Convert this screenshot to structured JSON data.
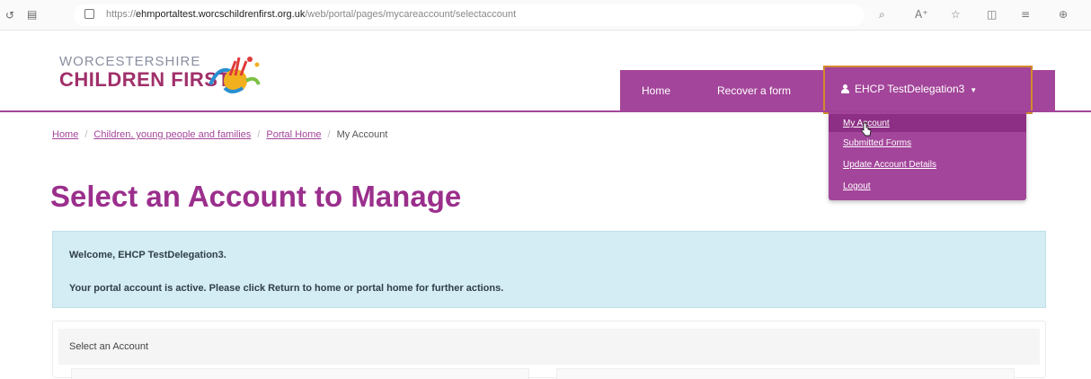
{
  "browser": {
    "url_prefix": "https://",
    "url_domain": "ehmportaltest.worcschildrenfirst.org.uk",
    "url_path": "/web/portal/pages/mycareaccount/selectaccount"
  },
  "brand": {
    "line1": "WORCESTERSHIRE",
    "line2": "CHILDREN FIRST"
  },
  "nav": {
    "home": "Home",
    "recover": "Recover a form",
    "user": "EHCP TestDelegation3"
  },
  "dropdown": {
    "items": [
      "My Account",
      "Submitted Forms",
      "Update Account Details",
      "Logout"
    ]
  },
  "breadcrumb": {
    "items": [
      "Home",
      "Children, young people and families",
      "Portal Home"
    ],
    "current": "My Account"
  },
  "page": {
    "title": "Select an Account to Manage"
  },
  "alert": {
    "welcome": "Welcome, EHCP TestDelegation3.",
    "message": "Your portal account is active. Please click Return to home or portal home for further actions."
  },
  "panel": {
    "heading": "Select an Account"
  },
  "colors": {
    "brand_purple": "#a3459a",
    "title_purple": "#9b2f8c",
    "alert_bg": "#d4ecf3",
    "focus_outline": "#d48a2a"
  }
}
